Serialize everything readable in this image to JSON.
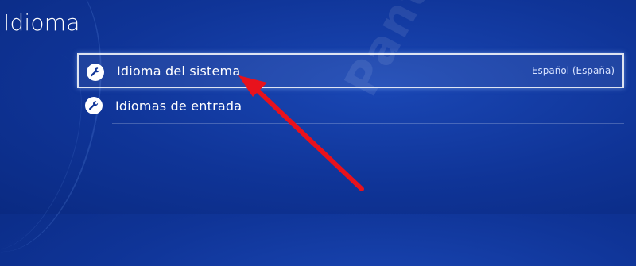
{
  "header": {
    "title": "Idioma"
  },
  "menu": {
    "items": [
      {
        "label": "Idioma del sistema",
        "value": "Español (España)",
        "icon": "wrench-icon"
      },
      {
        "label": "Idiomas de entrada",
        "value": "",
        "icon": "wrench-icon"
      }
    ]
  },
  "watermark": {
    "text": "Pantallaz"
  },
  "annotation": {
    "arrow_color": "#e8121c"
  },
  "colors": {
    "background": "#0f3497",
    "text": "#ffffff"
  }
}
